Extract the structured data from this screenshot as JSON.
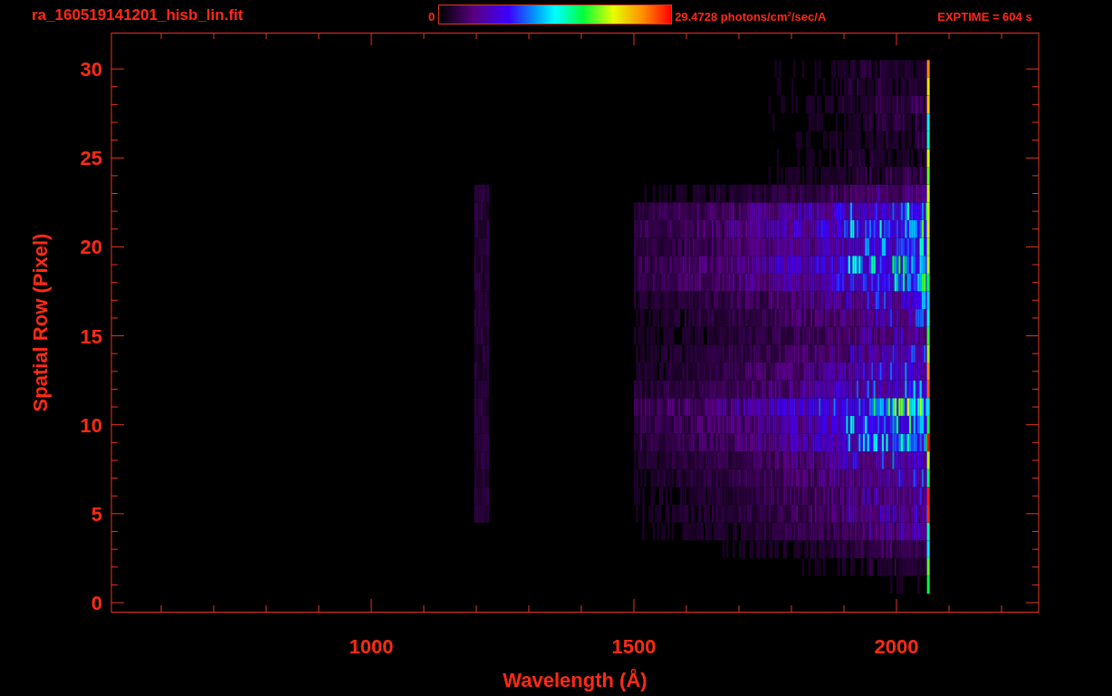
{
  "header": {
    "file_name": "ra_160519141201_hisb_lin.fit",
    "colorbar_min": "0",
    "colorbar_max": "29.4728 photons/cm$^{2}$/sec/A",
    "exposure": "EXPTIME = 604 s"
  },
  "plot": {
    "x_axis": {
      "label": "Wavelength (Å)",
      "ticks": [
        "1000",
        "1500",
        "2000"
      ]
    },
    "y_axis": {
      "label": "Spatial Row (Pixel)",
      "ticks": [
        "30",
        "25",
        "20",
        "15",
        "10",
        "5",
        "0"
      ]
    }
  }
}
